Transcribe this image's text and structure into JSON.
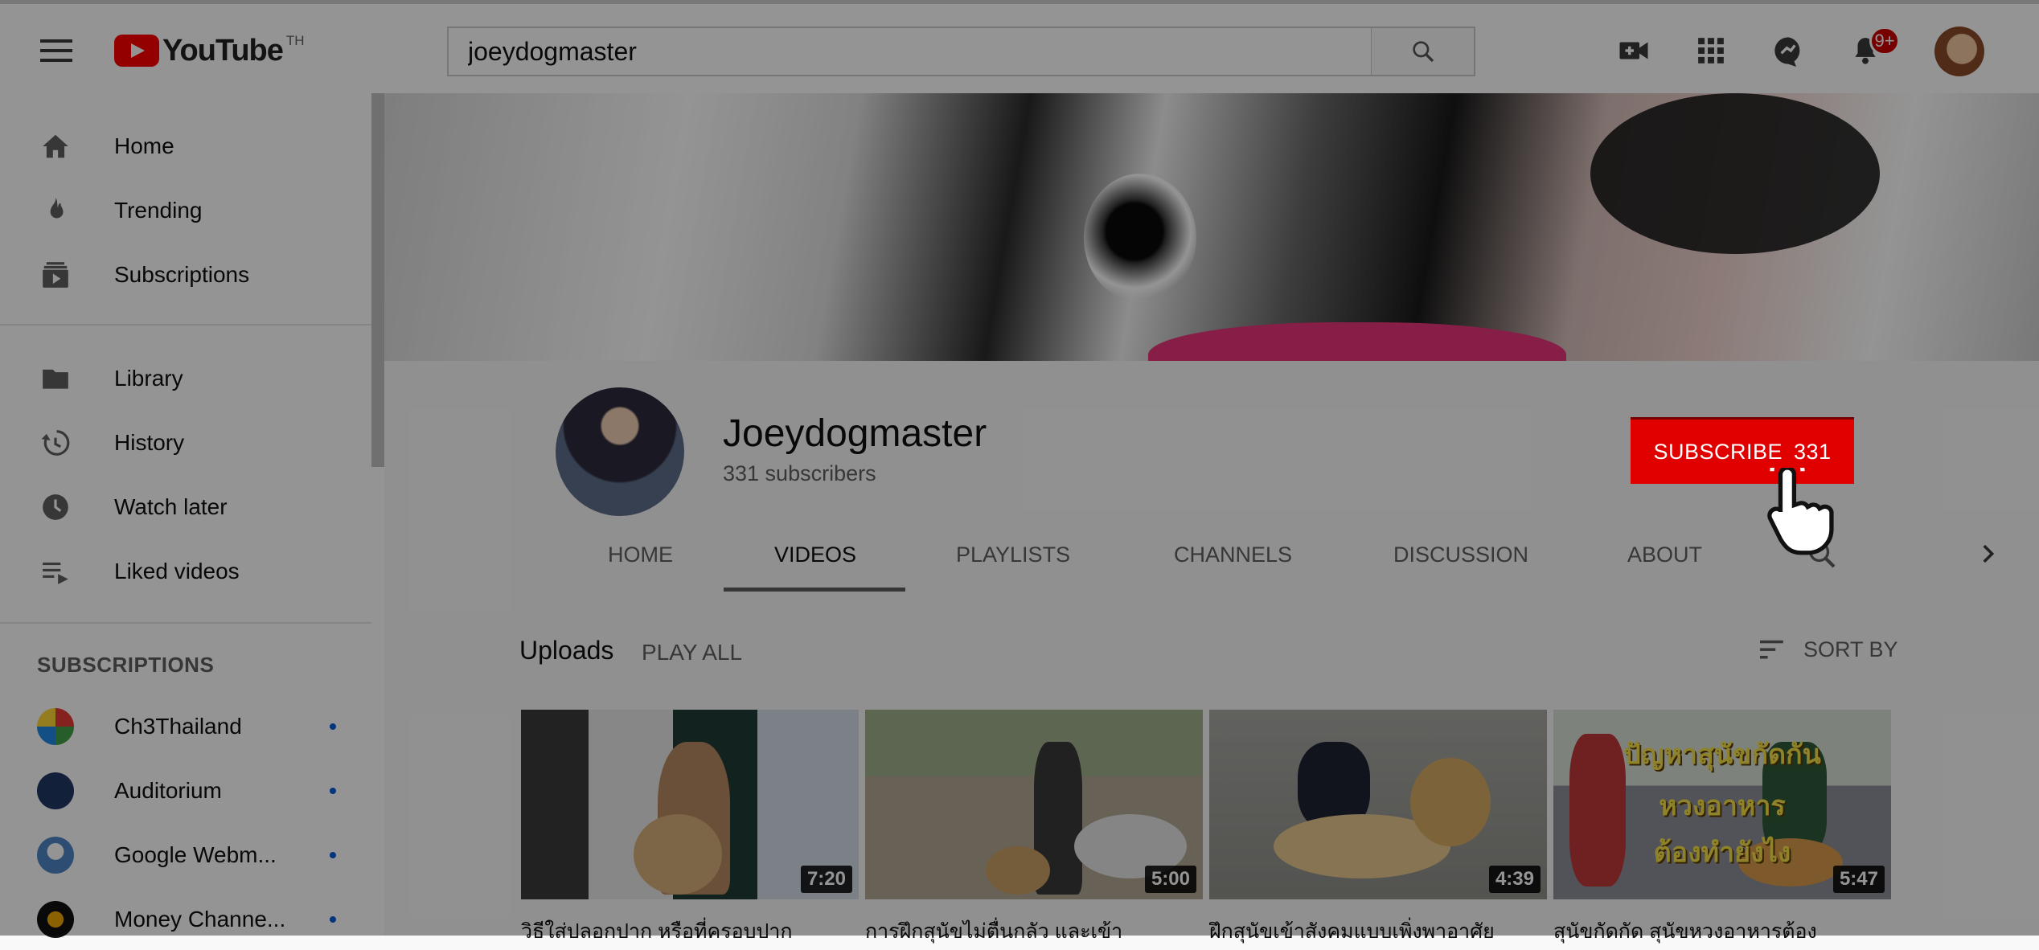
{
  "header": {
    "logo_text": "YouTube",
    "country_code": "TH",
    "search_value": "joeydogmaster",
    "notification_count": "9+"
  },
  "sidebar": {
    "items": [
      {
        "label": "Home",
        "icon": "home-icon"
      },
      {
        "label": "Trending",
        "icon": "flame-icon"
      },
      {
        "label": "Subscriptions",
        "icon": "subscriptions-icon"
      },
      {
        "label": "Library",
        "icon": "folder-icon"
      },
      {
        "label": "History",
        "icon": "history-icon"
      },
      {
        "label": "Watch later",
        "icon": "clock-icon"
      },
      {
        "label": "Liked videos",
        "icon": "playlist-icon"
      }
    ],
    "subscriptions_heading": "SUBSCRIPTIONS",
    "subscriptions": [
      {
        "name": "Ch3Thailand"
      },
      {
        "name": "Auditorium"
      },
      {
        "name": "Google Webm..."
      },
      {
        "name": "Money Channe..."
      }
    ]
  },
  "channel": {
    "name": "Joeydogmaster",
    "subscribers": "331 subscribers",
    "subscribe_label": "SUBSCRIBE",
    "subscribe_count": "331",
    "tabs": [
      "HOME",
      "VIDEOS",
      "PLAYLISTS",
      "CHANNELS",
      "DISCUSSION",
      "ABOUT"
    ],
    "active_tab": "VIDEOS"
  },
  "uploads": {
    "heading": "Uploads",
    "play_all": "PLAY ALL",
    "sort_by": "SORT BY",
    "videos": [
      {
        "duration": "7:20",
        "title": "วิธีใส่ปลอกปาก หรือที่ครอบปาก"
      },
      {
        "duration": "5:00",
        "title": "การฝึกสุนัขไม่ตื่นกลัว และเข้า"
      },
      {
        "duration": "4:39",
        "title": "ฝึกสุนัขเข้าสังคมแบบเพิ่งพาอาศัย"
      },
      {
        "duration": "5:47",
        "title": "สุนัขกัดกัด สุนัขหวงอาหารต้อง",
        "overlay": [
          "ปัญหาสุนัขกัดกัน",
          "หวงอาหาร",
          "ต้องทำยังไง"
        ]
      }
    ]
  },
  "colors": {
    "brand_red": "#ff0000",
    "subscribe_red": "#cc0000",
    "link_blue": "#065fd4"
  }
}
